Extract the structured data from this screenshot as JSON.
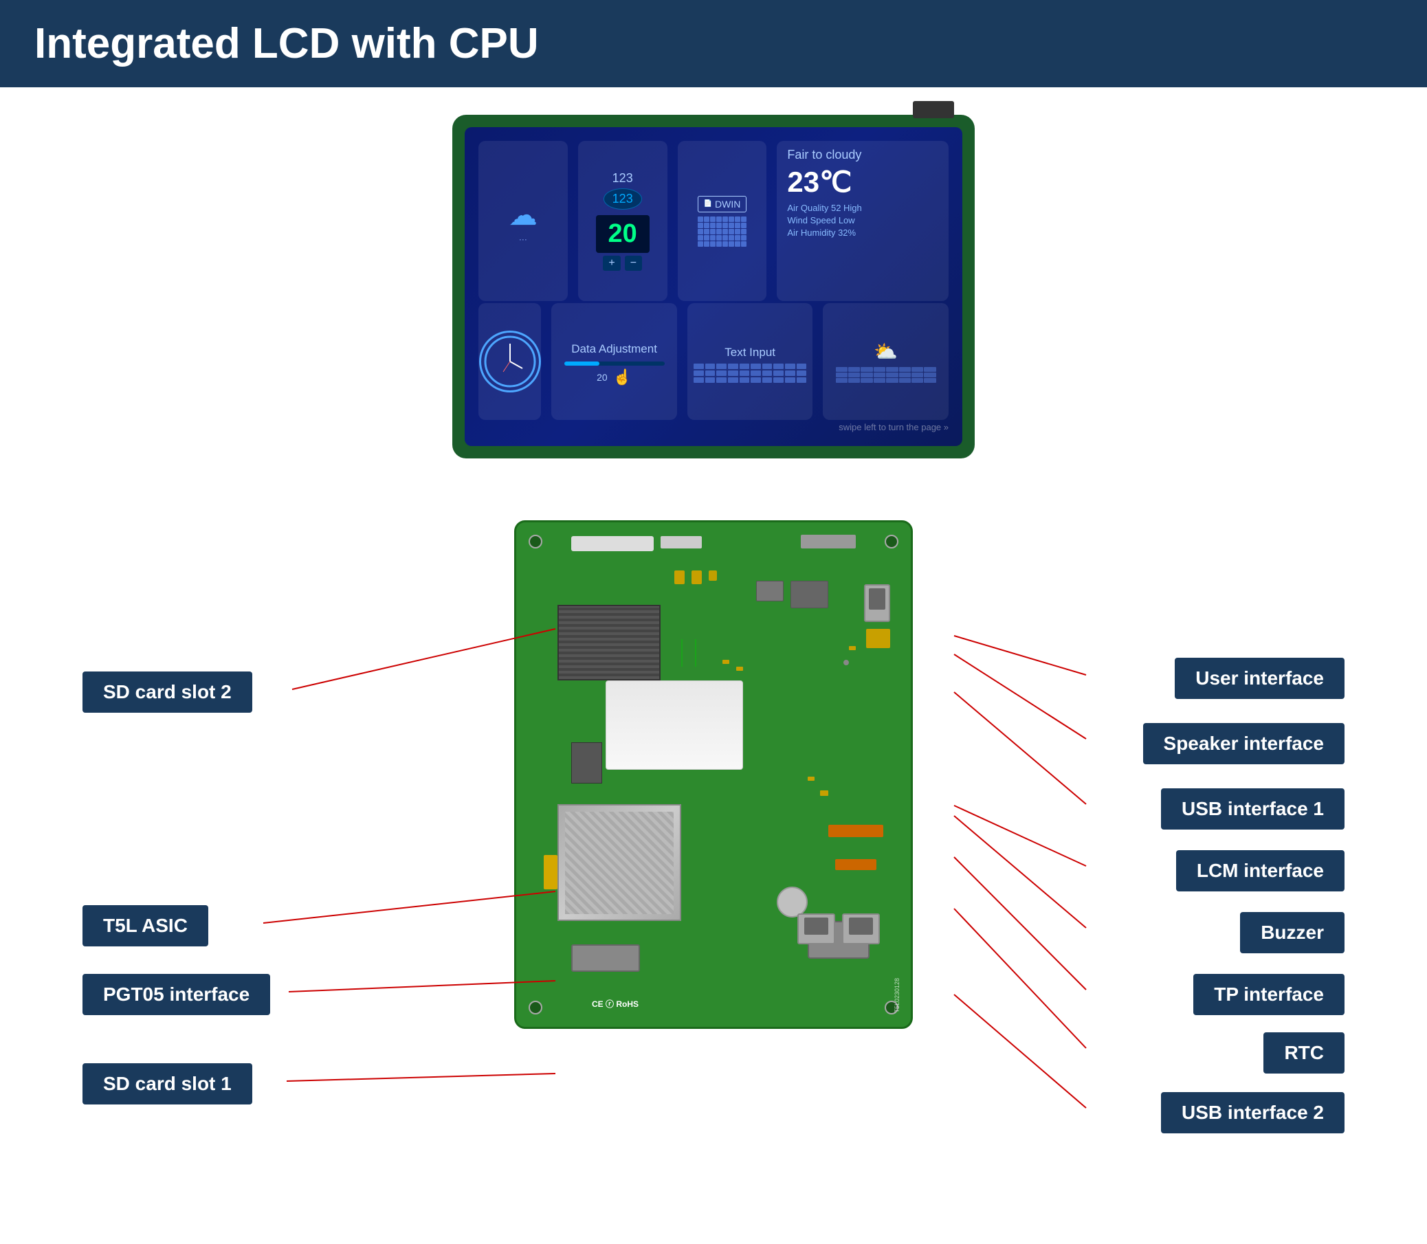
{
  "header": {
    "title": "Integrated LCD with CPU",
    "bg_color": "#1a3a5c"
  },
  "lcd": {
    "weather_title": "Fair to cloudy",
    "weather_temp": "23℃",
    "air_quality": "Air Quality   52 High",
    "wind_speed": "Wind Speed   Low",
    "air_humidity": "Air Humidity   32%",
    "brand": "DWIN",
    "data_adj": "Data Adjustment",
    "text_input": "Text Input",
    "nav_hint": "swipe left to turn the page  »",
    "counter_val": "20"
  },
  "labels": {
    "left": {
      "sd_card_slot_2": "SD card slot 2",
      "t5l_asic": "T5L ASIC",
      "pgt05_interface": "PGT05 interface",
      "sd_card_slot_1": "SD card slot 1"
    },
    "right": {
      "user_interface": "User interface",
      "speaker_interface": "Speaker interface",
      "usb_interface_1": "USB interface 1",
      "lcm_interface": "LCM interface",
      "buzzer": "Buzzer",
      "tp_interface": "TP interface",
      "rtc": "RTC",
      "usb_interface_2": "USB interface 2"
    }
  }
}
